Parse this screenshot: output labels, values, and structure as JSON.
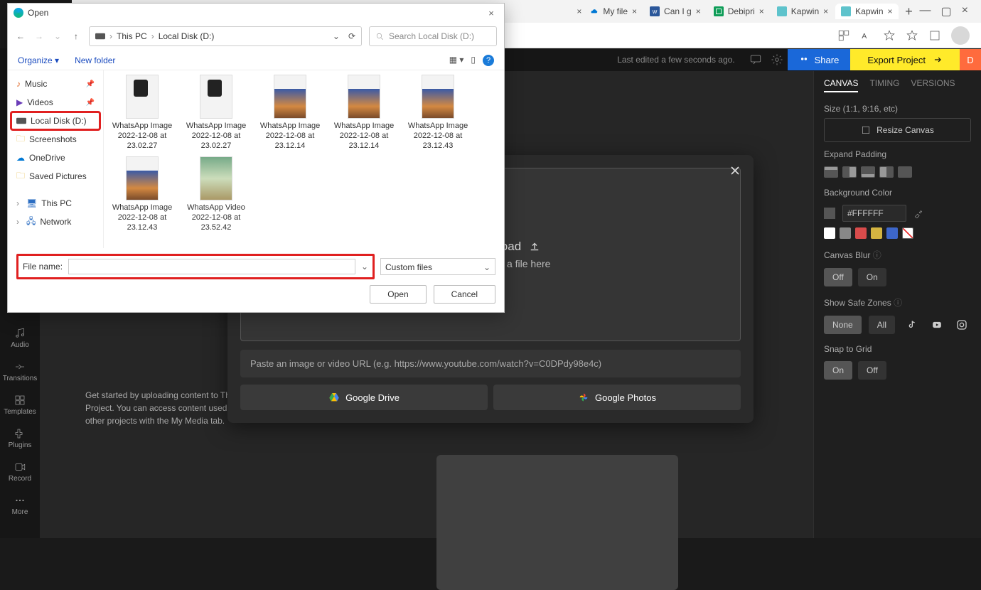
{
  "browser": {
    "tabs": [
      {
        "label": "My file"
      },
      {
        "label": "Can I g"
      },
      {
        "label": "Debipri"
      },
      {
        "label": "Kapwin"
      },
      {
        "label": "Kapwin",
        "active": true
      }
    ]
  },
  "kap": {
    "last_edited": "Last edited a few seconds ago.",
    "share": "Share",
    "export": "Export Project",
    "user_initial": "D"
  },
  "leftnav": {
    "audio": "Audio",
    "transitions": "Transitions",
    "templates": "Templates",
    "plugins": "Plugins",
    "record": "Record",
    "more": "More"
  },
  "upload_hint": "Get started by uploading content to This Project. You can access content used in other projects with the My Media tab.",
  "upload_modal": {
    "title": "Click to Upload",
    "subtitle": "or drag and drop a file here",
    "paste_placeholder": "Paste an image or video URL (e.g. https://www.youtube.com/watch?v=C0DPdy98e4c)",
    "gdrive": "Google Drive",
    "gphotos": "Google Photos"
  },
  "rside": {
    "tabs": {
      "canvas": "CANVAS",
      "timing": "TIMING",
      "versions": "VERSIONS"
    },
    "size_label": "Size (1:1, 9:16, etc)",
    "resize": "Resize Canvas",
    "expand_padding": "Expand Padding",
    "bg_label": "Background Color",
    "hex": "#FFFFFF",
    "blur_label": "Canvas Blur",
    "off": "Off",
    "on": "On",
    "safe_label": "Show Safe Zones",
    "none": "None",
    "all": "All",
    "snap_label": "Snap to Grid"
  },
  "filedlg": {
    "title": "Open",
    "path_pc": "This PC",
    "path_drive": "Local Disk (D:)",
    "search_placeholder": "Search Local Disk (D:)",
    "organize": "Organize",
    "new_folder": "New folder",
    "sidebar": [
      "Music",
      "Videos",
      "Local Disk (D:)",
      "Screenshots",
      "OneDrive",
      "Saved Pictures",
      "This PC",
      "Network"
    ],
    "files": [
      "WhatsApp Image 2022-12-08 at 23.02.27",
      "WhatsApp Image 2022-12-08 at 23.02.27",
      "WhatsApp Image 2022-12-08 at 23.12.14",
      "WhatsApp Image 2022-12-08 at 23.12.14",
      "WhatsApp Image 2022-12-08 at 23.12.43",
      "WhatsApp Image 2022-12-08 at 23.12.43",
      "WhatsApp Video 2022-12-08 at 23.52.42"
    ],
    "filename_label": "File name:",
    "filetype": "Custom files",
    "open": "Open",
    "cancel": "Cancel"
  }
}
